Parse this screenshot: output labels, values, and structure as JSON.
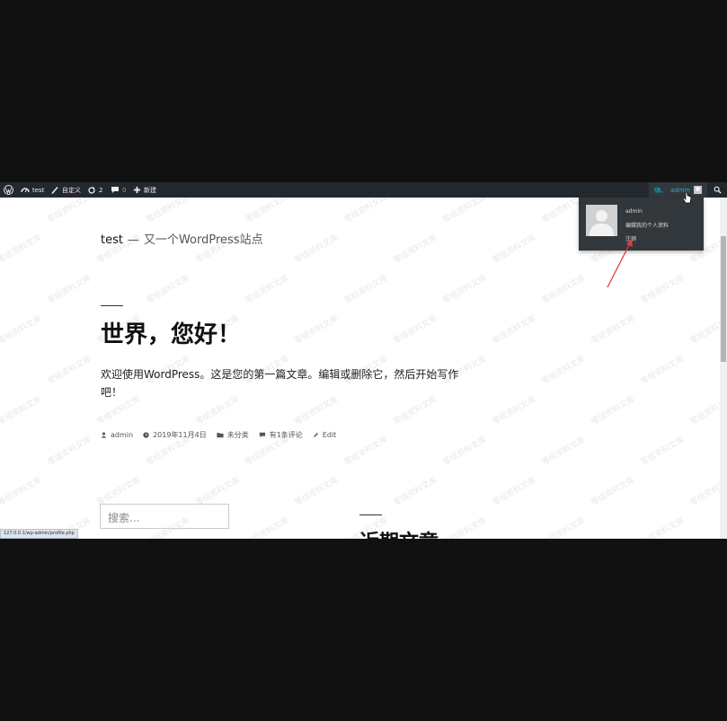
{
  "adminbar": {
    "site_name": "test",
    "customize_label": "自定义",
    "updates_count": "2",
    "comments_count": "0",
    "new_label": "新建",
    "account_greeting": "嗨，",
    "account_name": "admin"
  },
  "account_menu": {
    "display_name": "admin",
    "edit_profile": "编辑我的个人资料",
    "logout": "注销"
  },
  "site": {
    "title": "test",
    "separator": "—",
    "description": "又一个WordPress站点"
  },
  "post": {
    "title": "世界，您好！",
    "body": "欢迎使用WordPress。这是您的第一篇文章。编辑或删除它，然后开始写作吧！",
    "author": "admin",
    "date": "2019年11月4日",
    "category": "未分类",
    "comments": "有1条评论",
    "edit": "Edit"
  },
  "sidebar": {
    "search_placeholder": "搜索...",
    "recent_posts_title": "近期文章"
  },
  "status_url": "127.0.0.1/wp-admin/profile.php",
  "watermark_text": "零组资料文库",
  "colors": {
    "admin_bar": "#23282d",
    "dropdown": "#32373c",
    "account_link": "#00b9eb",
    "annotation_arrow": "#e53935"
  }
}
